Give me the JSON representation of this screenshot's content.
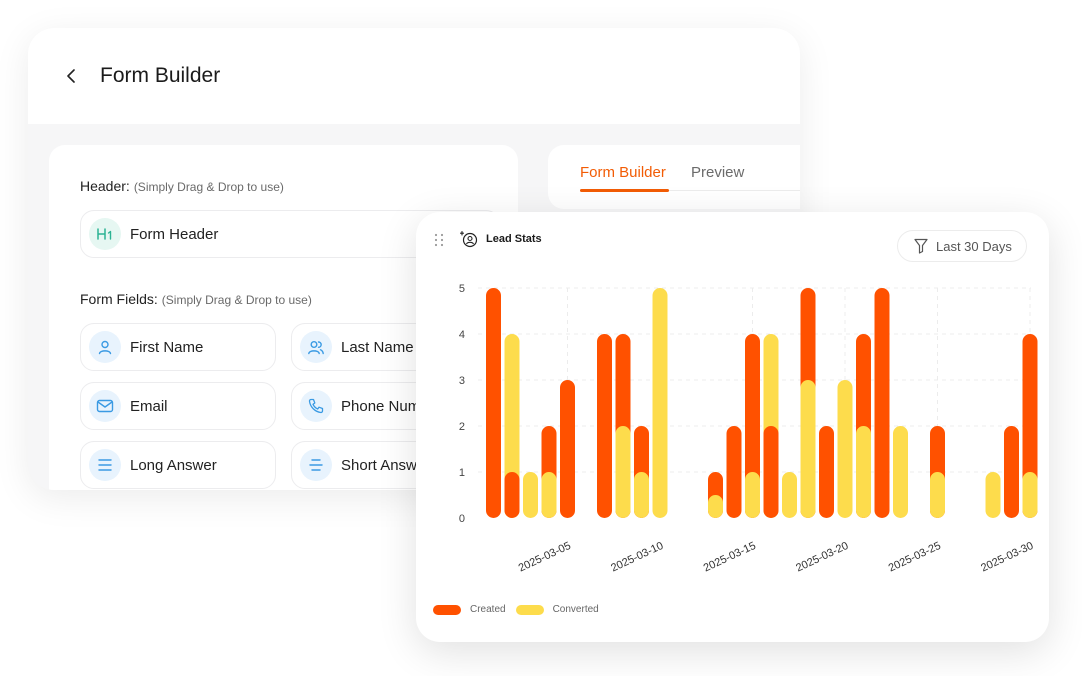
{
  "form_builder": {
    "title": "Form Builder",
    "header_section": {
      "label": "Header:",
      "hint": "(Simply Drag & Drop to use)"
    },
    "header_items": [
      {
        "label": "Form Header",
        "icon": "heading-1-icon"
      }
    ],
    "fields_section": {
      "label": "Form Fields:",
      "hint": "(Simply Drag & Drop to use)"
    },
    "fields": [
      {
        "label": "First Name",
        "icon": "user-icon"
      },
      {
        "label": "Last Name",
        "icon": "users-icon"
      },
      {
        "label": "Email",
        "icon": "mail-icon"
      },
      {
        "label": "Phone Num",
        "icon": "phone-icon"
      },
      {
        "label": "Long Answer",
        "icon": "text-lines-icon"
      },
      {
        "label": "Short Answ",
        "icon": "short-text-icon"
      }
    ],
    "tabs": [
      {
        "label": "Form Builder",
        "active": true
      },
      {
        "label": "Preview",
        "active": false
      }
    ]
  },
  "lead_stats": {
    "title": "Lead Stats",
    "filter_label": "Last 30 Days"
  },
  "colors": {
    "accent": "#f25c05",
    "created": "#ff5100",
    "converted": "#fddc4c",
    "icon_blue": "#3a9ae3",
    "icon_green": "#2bb393"
  },
  "chart_data": {
    "type": "bar",
    "x_ticks": [
      "2025-03-05",
      "2025-03-10",
      "2025-03-15",
      "2025-03-20",
      "2025-03-25",
      "2025-03-30"
    ],
    "ylim": [
      0,
      5
    ],
    "y_ticks": [
      0,
      1,
      2,
      3,
      4,
      5
    ],
    "grid": true,
    "legend_position": "bottom-left",
    "dates": [
      "2025-03-01",
      "2025-03-02",
      "2025-03-03",
      "2025-03-04",
      "2025-03-05",
      "2025-03-06",
      "2025-03-07",
      "2025-03-08",
      "2025-03-09",
      "2025-03-10",
      "2025-03-11",
      "2025-03-12",
      "2025-03-13",
      "2025-03-14",
      "2025-03-15",
      "2025-03-16",
      "2025-03-17",
      "2025-03-18",
      "2025-03-19",
      "2025-03-20",
      "2025-03-21",
      "2025-03-22",
      "2025-03-23",
      "2025-03-24",
      "2025-03-25",
      "2025-03-26",
      "2025-03-27",
      "2025-03-28",
      "2025-03-29",
      "2025-03-30"
    ],
    "series": [
      {
        "name": "Created",
        "color": "#ff5100",
        "values": [
          5,
          1,
          0,
          2,
          3,
          0,
          4,
          4,
          2,
          0,
          0,
          0,
          1,
          2,
          4,
          2,
          0,
          5,
          2,
          0,
          4,
          5,
          0,
          0,
          2,
          0,
          0,
          0,
          2,
          4
        ]
      },
      {
        "name": "Converted",
        "color": "#fddc4c",
        "values": [
          0,
          4,
          1,
          1,
          0,
          0,
          0,
          2,
          1,
          5,
          0,
          0,
          0.5,
          0,
          1,
          4,
          1,
          3,
          0,
          3,
          2,
          0,
          2,
          0,
          1,
          0,
          0,
          1,
          0,
          1
        ]
      }
    ]
  }
}
